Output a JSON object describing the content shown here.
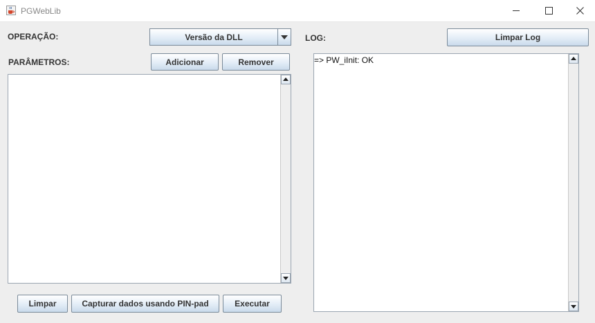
{
  "window": {
    "title": "PGWebLib",
    "icon": "java-cup-icon"
  },
  "left": {
    "operation_label": "OPERAÇÃO:",
    "operation_selected": "Versão da DLL",
    "params_label": "PARÂMETROS:",
    "add_button": "Adicionar",
    "remove_button": "Remover",
    "params_text": ""
  },
  "right": {
    "log_label": "LOG:",
    "clear_log_button": "Limpar Log",
    "log_lines": [
      "=> PW_iInit: OK"
    ]
  },
  "footer": {
    "clear_button": "Limpar",
    "capture_button": "Capturar dados usando PIN-pad",
    "execute_button": "Executar"
  },
  "colors": {
    "background": "#eeeeee",
    "button_gradient_top": "#ffffff",
    "button_gradient_bottom": "#c9daeb",
    "border": "#7a8a99"
  }
}
